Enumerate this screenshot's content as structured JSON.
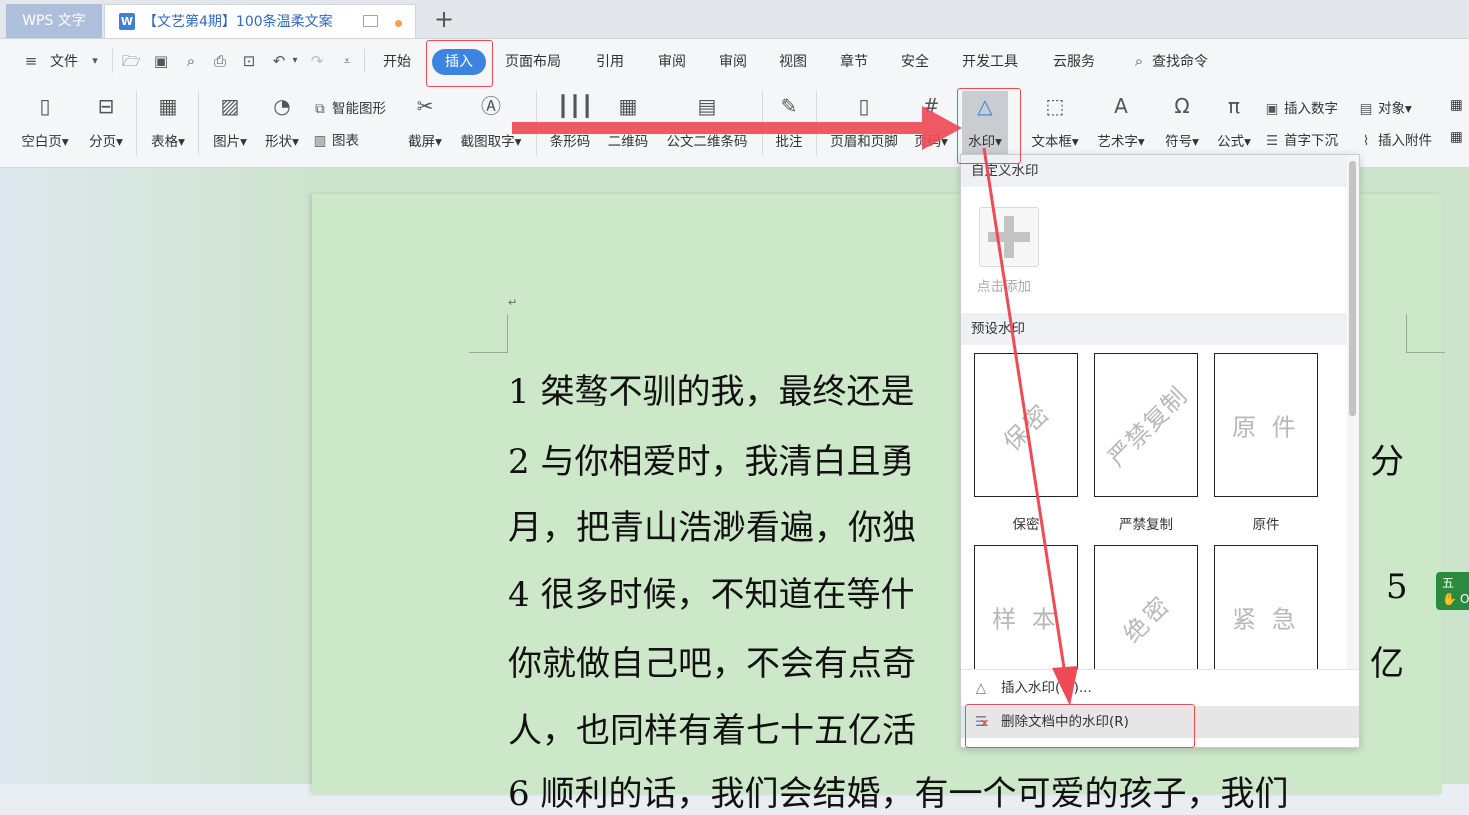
{
  "titlebar": {
    "app_tab": "WPS 文字",
    "doc_icon": "W",
    "doc_tab": "【文艺第4期】100条温柔文案",
    "new_tab": "+"
  },
  "menubar": {
    "file": "文件",
    "tabs": [
      "开始",
      "插入",
      "页面布局",
      "引用",
      "审阅",
      "审阅",
      "视图",
      "章节",
      "安全",
      "开发工具",
      "云服务"
    ],
    "search": "查找命令"
  },
  "ribbon": {
    "blank_page": "空白页",
    "page_break": "分页",
    "table": "表格",
    "picture": "图片",
    "shape": "形状",
    "smart_shape": "智能图形",
    "chart": "图表",
    "screenshot": "截屏",
    "ocr": "截图取字",
    "barcode": "条形码",
    "qrcode": "二维码",
    "official_barcode": "公文二维条码",
    "comment": "批注",
    "header_footer": "页眉和页脚",
    "page_number": "页码",
    "watermark": "水印",
    "textbox": "文本框",
    "wordart": "艺术字",
    "symbol": "符号",
    "formula": "公式",
    "insert_number": "插入数字",
    "object": "对象",
    "drop_cap": "首字下沉",
    "attachment": "插入附件"
  },
  "document": {
    "lines": [
      "1 桀骜不驯的我，最终还是",
      "2 与你相爱时，我清白且勇",
      "月，把青山浩渺看遍，你独",
      "4 很多时候，不知道在等什",
      "你就做自己吧，不会有点奇",
      "人，也同样有着七十五亿活",
      "6 顺利的话，我们会结婚，有一个可爱的孩子，我们"
    ],
    "right_fragments": [
      "分",
      "5",
      "亿"
    ]
  },
  "side_badge": {
    "top": "五",
    "bottom": "O"
  },
  "watermark_panel": {
    "custom_header": "自定义水印",
    "add_label": "点击添加",
    "preset_header": "预设水印",
    "presets": [
      {
        "text": "保密",
        "label": "保密"
      },
      {
        "text": "严禁复制",
        "label": "严禁复制"
      },
      {
        "text": "原 件",
        "label": "原件"
      },
      {
        "text": "样 本",
        "label": ""
      },
      {
        "text": "绝密",
        "label": ""
      },
      {
        "text": "紧 急",
        "label": ""
      }
    ],
    "insert": "插入水印(W)...",
    "delete": "删除文档中的水印(R)"
  },
  "colors": {
    "accent": "#3c84e0",
    "annotation": "#ee4b57",
    "page": "#cde8c9"
  }
}
